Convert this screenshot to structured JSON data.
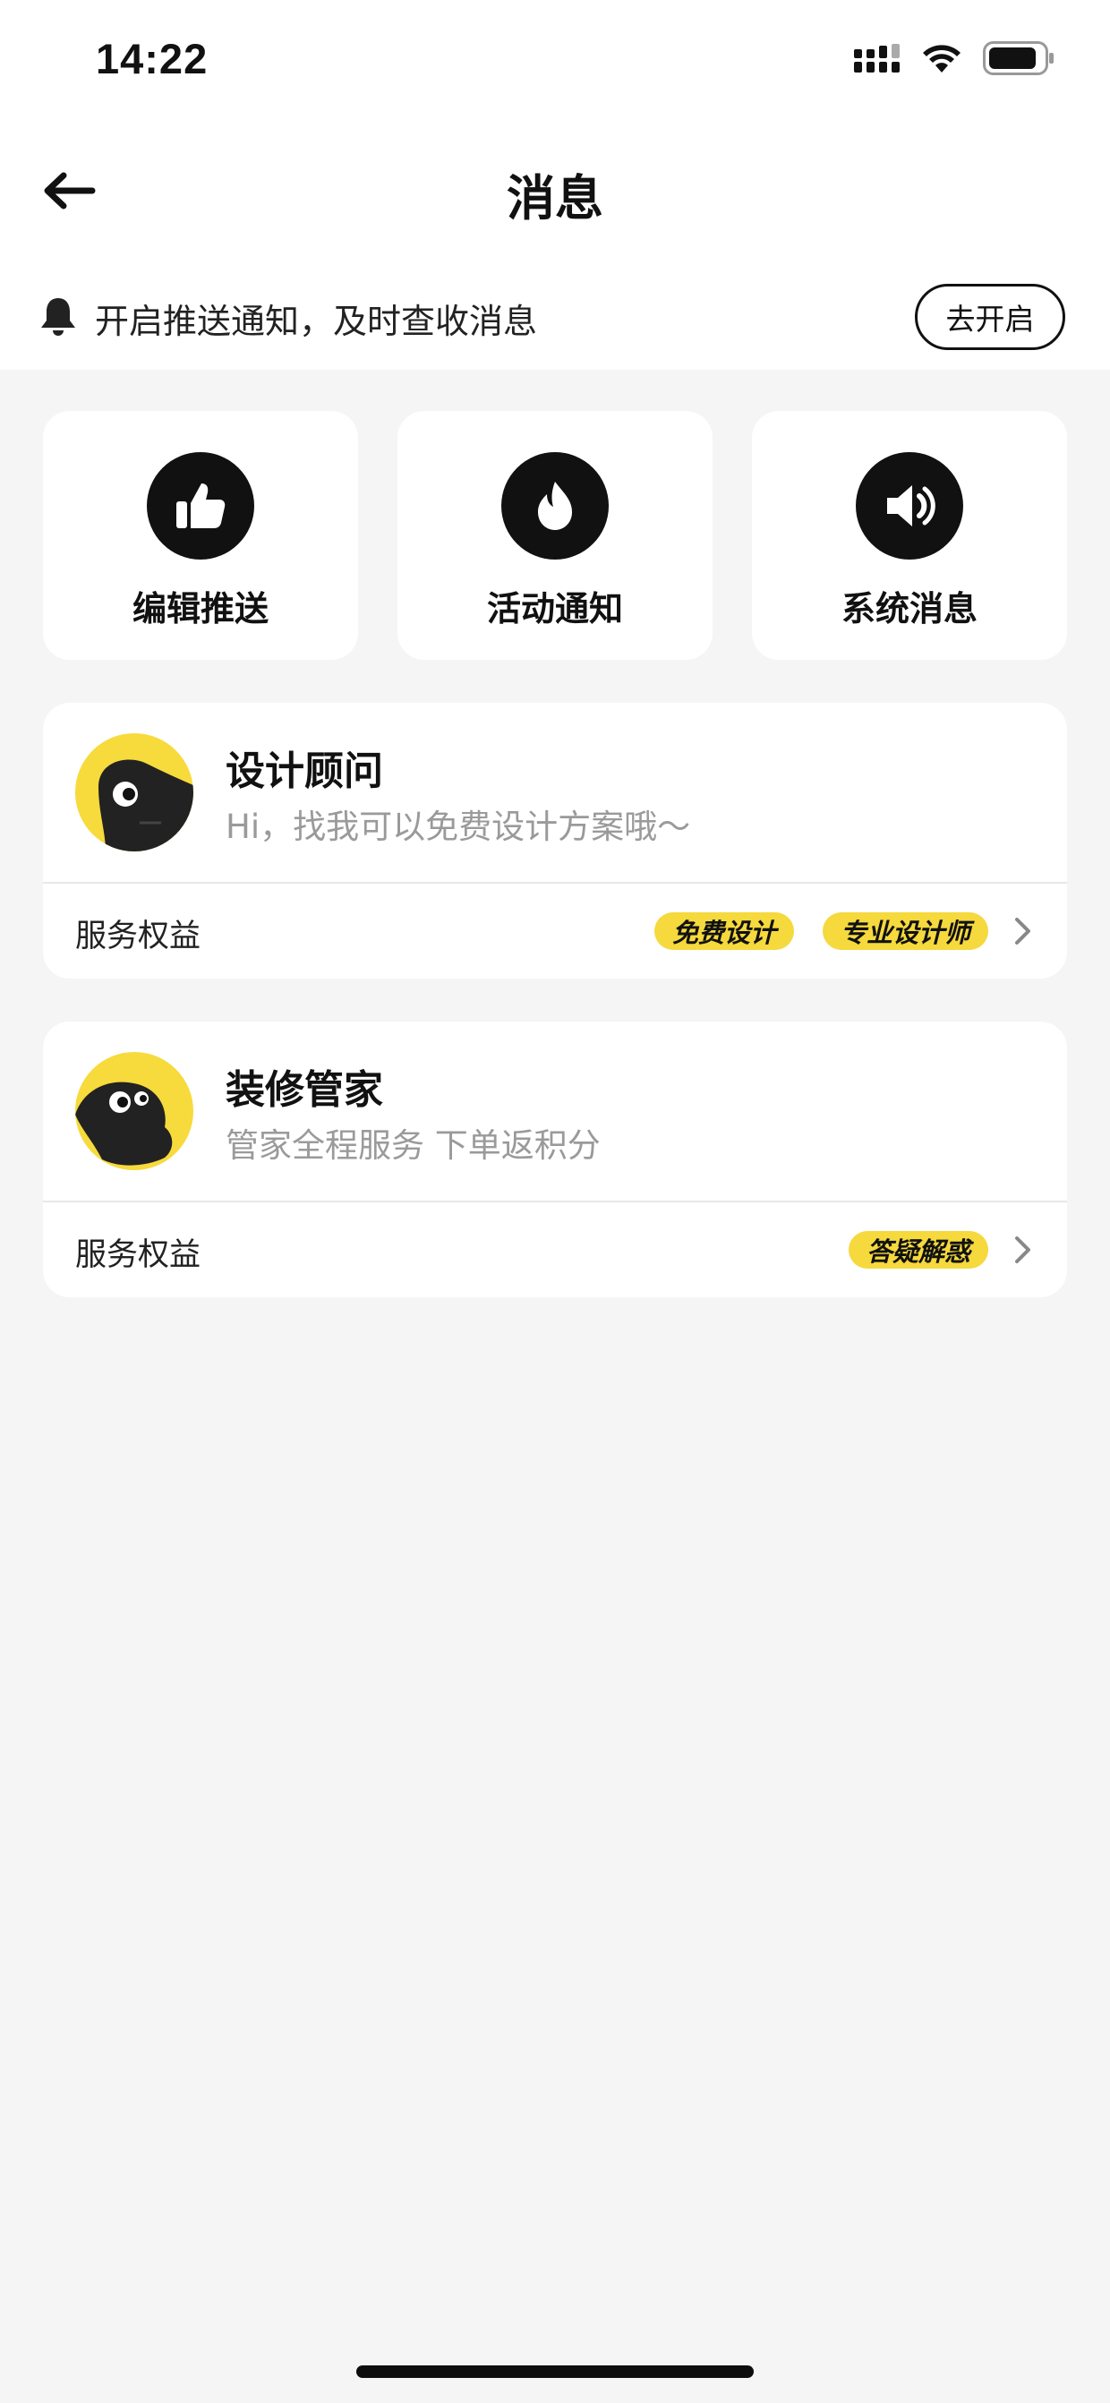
{
  "status_bar": {
    "time": "14:22"
  },
  "header": {
    "title": "消息"
  },
  "push_banner": {
    "text": "开启推送通知，及时查收消息",
    "button": "去开启"
  },
  "quick_actions": [
    {
      "label": "编辑推送",
      "icon": "thumbs-up-icon"
    },
    {
      "label": "活动通知",
      "icon": "flame-icon"
    },
    {
      "label": "系统消息",
      "icon": "speaker-icon"
    }
  ],
  "services": [
    {
      "name": "设计顾问",
      "description": "Hi，找我可以免费设计方案哦～",
      "benefits_label": "服务权益",
      "tags": [
        "免费设计",
        "专业设计师"
      ]
    },
    {
      "name": "装修管家",
      "description": "管家全程服务 下单返积分",
      "benefits_label": "服务权益",
      "tags": [
        "答疑解惑"
      ]
    }
  ],
  "colors": {
    "accent": "#f7da3c",
    "background": "#f5f5f5",
    "card": "#ffffff"
  }
}
